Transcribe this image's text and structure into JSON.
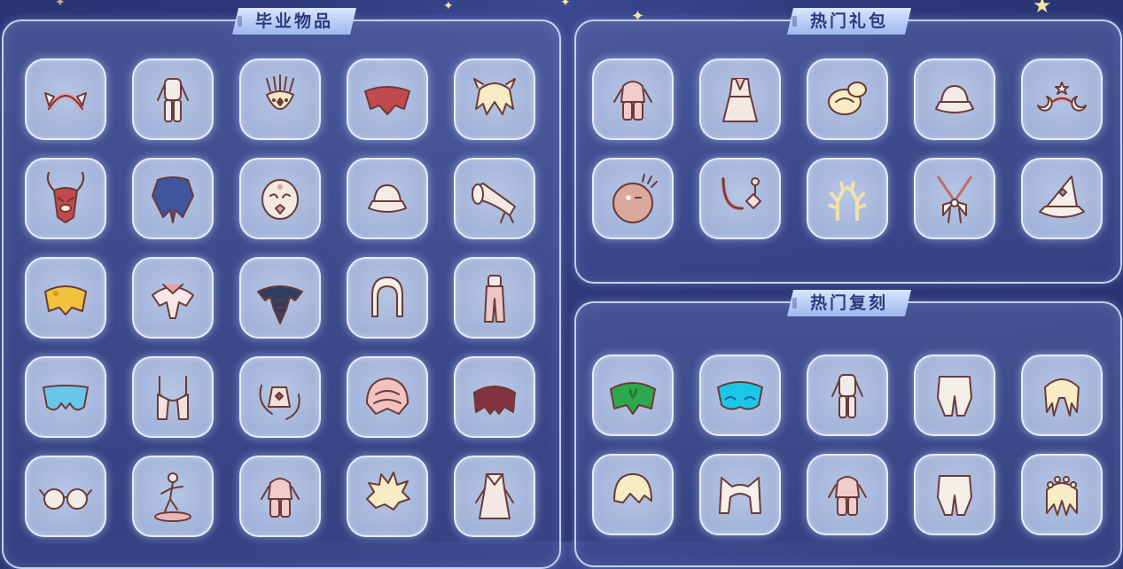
{
  "sections": {
    "graduation": {
      "title": "毕业物品"
    },
    "gift": {
      "title": "热门礼包"
    },
    "rerun": {
      "title": "热门复刻"
    }
  },
  "graduation_items": [
    "wing-headband-icon",
    "white-outfit-icon",
    "feather-mask-icon",
    "red-cape-icon",
    "cream-hair-icon",
    "horned-mask-icon",
    "blue-cape-icon",
    "white-mask-icon",
    "white-hat-icon",
    "horn-instrument-icon",
    "yellow-cape-icon",
    "pink-white-cape-icon",
    "dark-blue-cape-icon",
    "white-hood-icon",
    "pink-pants-icon",
    "blue-wing-cape-icon",
    "pink-scarf-icon",
    "ornament-accessory-icon",
    "pink-shell-cape-icon",
    "maroon-cape-icon",
    "glasses-icon",
    "dancer-prop-icon",
    "pink-outfit-icon",
    "spiky-hair-icon",
    "white-robe-icon"
  ],
  "gift_items": [
    "pink-outfit-icon",
    "pink-dress-icon",
    "cream-hair-bun-icon",
    "white-hat-icon",
    "star-moon-headband-icon",
    "round-mask-icon",
    "necklace-icon",
    "antler-icon",
    "bow-necklace-icon",
    "witch-hat-icon"
  ],
  "rerun_items": [
    "green-cape-icon",
    "cyan-cape-icon",
    "white-outfit-icon",
    "white-pants-icon",
    "curly-hair-icon",
    "short-hair-icon",
    "cat-hood-icon",
    "pink-outfit-icon",
    "white-pants-icon",
    "flower-crown-icon"
  ],
  "colors": {
    "panel_border": "#dce8ff",
    "tab_bg": "#c2d3f7",
    "tab_text": "#2b3b7a",
    "slot_bg": "#a9b9dd"
  }
}
